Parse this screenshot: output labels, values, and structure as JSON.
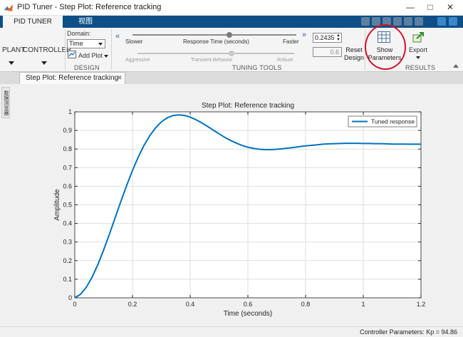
{
  "window": {
    "title": "PID Tuner - Step Plot: Reference tracking",
    "buttons": {
      "minimize": "—",
      "maximize": "□",
      "close": "✕"
    }
  },
  "ribbon_tabs": [
    {
      "label": "PID TUNER",
      "active": true
    },
    {
      "label": "视图",
      "active": false
    }
  ],
  "ribbon": {
    "plant_label": "PLANT",
    "controller_label": "CONTROLLER",
    "domain": {
      "label": "Domain:",
      "value": "Time"
    },
    "add_plot_label": "Add Plot",
    "groups": {
      "design": "DESIGN",
      "tuning_tools": "TUNING TOOLS",
      "results": "RESULTS"
    },
    "response_time": {
      "min_label": "Slower",
      "center_label": "Response Time (seconds)",
      "max_label": "Faster",
      "value": "0.2435",
      "level": 0.59
    },
    "transient_behavior": {
      "min_label": "Aggressive",
      "center_label": "Transient Behavior",
      "max_label": "Robust",
      "value": "0.6",
      "level": 0.6
    },
    "reset_design": {
      "line1": "Reset",
      "line2": "Design"
    },
    "show_parameters": {
      "line1": "Show",
      "line2": "Parameters"
    },
    "export_label": "Export",
    "collapse_glyph": "«",
    "expand_glyph": "»"
  },
  "doc_tab": {
    "label": "Step Plot: Reference tracking",
    "close_glyph": "✖"
  },
  "side_panel_label": "数据浏览器",
  "chart_data": {
    "type": "line",
    "title": "Step Plot: Reference tracking",
    "xlabel": "Time (seconds)",
    "ylabel": "Amplitude",
    "xlim": [
      0,
      1.2
    ],
    "ylim": [
      0,
      1
    ],
    "xticks": [
      0,
      0.2,
      0.4,
      0.6,
      0.8,
      1,
      1.2
    ],
    "xtick_labels": [
      "0",
      "0.2",
      "0.4",
      "0.6",
      "0.8",
      "1",
      "1.2"
    ],
    "yticks": [
      0,
      0.1,
      0.2,
      0.3,
      0.4,
      0.5,
      0.6,
      0.7,
      0.8,
      0.9,
      1
    ],
    "ytick_labels": [
      "0",
      "0.1",
      "0.2",
      "0.3",
      "0.4",
      "0.5",
      "0.6",
      "0.7",
      "0.8",
      "0.9",
      "1"
    ],
    "grid": true,
    "legend_position": "top-right",
    "series": [
      {
        "name": "Tuned response",
        "color": "#0072bd",
        "x": [
          0,
          0.02,
          0.04,
          0.06,
          0.08,
          0.1,
          0.12,
          0.14,
          0.16,
          0.18,
          0.2,
          0.22,
          0.24,
          0.26,
          0.28,
          0.3,
          0.32,
          0.34,
          0.36,
          0.38,
          0.4,
          0.42,
          0.44,
          0.46,
          0.48,
          0.5,
          0.52,
          0.54,
          0.56,
          0.58,
          0.6,
          0.62,
          0.64,
          0.66,
          0.68,
          0.7,
          0.72,
          0.74,
          0.76,
          0.78,
          0.8,
          0.82,
          0.84,
          0.86,
          0.88,
          0.9,
          0.92,
          0.94,
          0.96,
          0.98,
          1.0,
          1.02,
          1.04,
          1.06,
          1.08,
          1.1,
          1.12,
          1.14,
          1.16,
          1.18,
          1.2
        ],
        "y": [
          0,
          0.019,
          0.057,
          0.111,
          0.179,
          0.257,
          0.342,
          0.431,
          0.52,
          0.605,
          0.685,
          0.757,
          0.82,
          0.872,
          0.914,
          0.946,
          0.968,
          0.98,
          0.984,
          0.981,
          0.972,
          0.958,
          0.941,
          0.922,
          0.902,
          0.882,
          0.863,
          0.846,
          0.832,
          0.819,
          0.81,
          0.803,
          0.799,
          0.797,
          0.797,
          0.799,
          0.802,
          0.805,
          0.809,
          0.813,
          0.817,
          0.82,
          0.823,
          0.826,
          0.828,
          0.829,
          0.83,
          0.831,
          0.831,
          0.831,
          0.83,
          0.83,
          0.829,
          0.829,
          0.828,
          0.827,
          0.827,
          0.827,
          0.826,
          0.826,
          0.826
        ]
      }
    ]
  },
  "status": {
    "text": "Controller Parameters: Kp = 94.86"
  },
  "colors": {
    "tabstrip": "#0e4f87",
    "annotation": "#d4122a",
    "series": "#0072bd"
  }
}
